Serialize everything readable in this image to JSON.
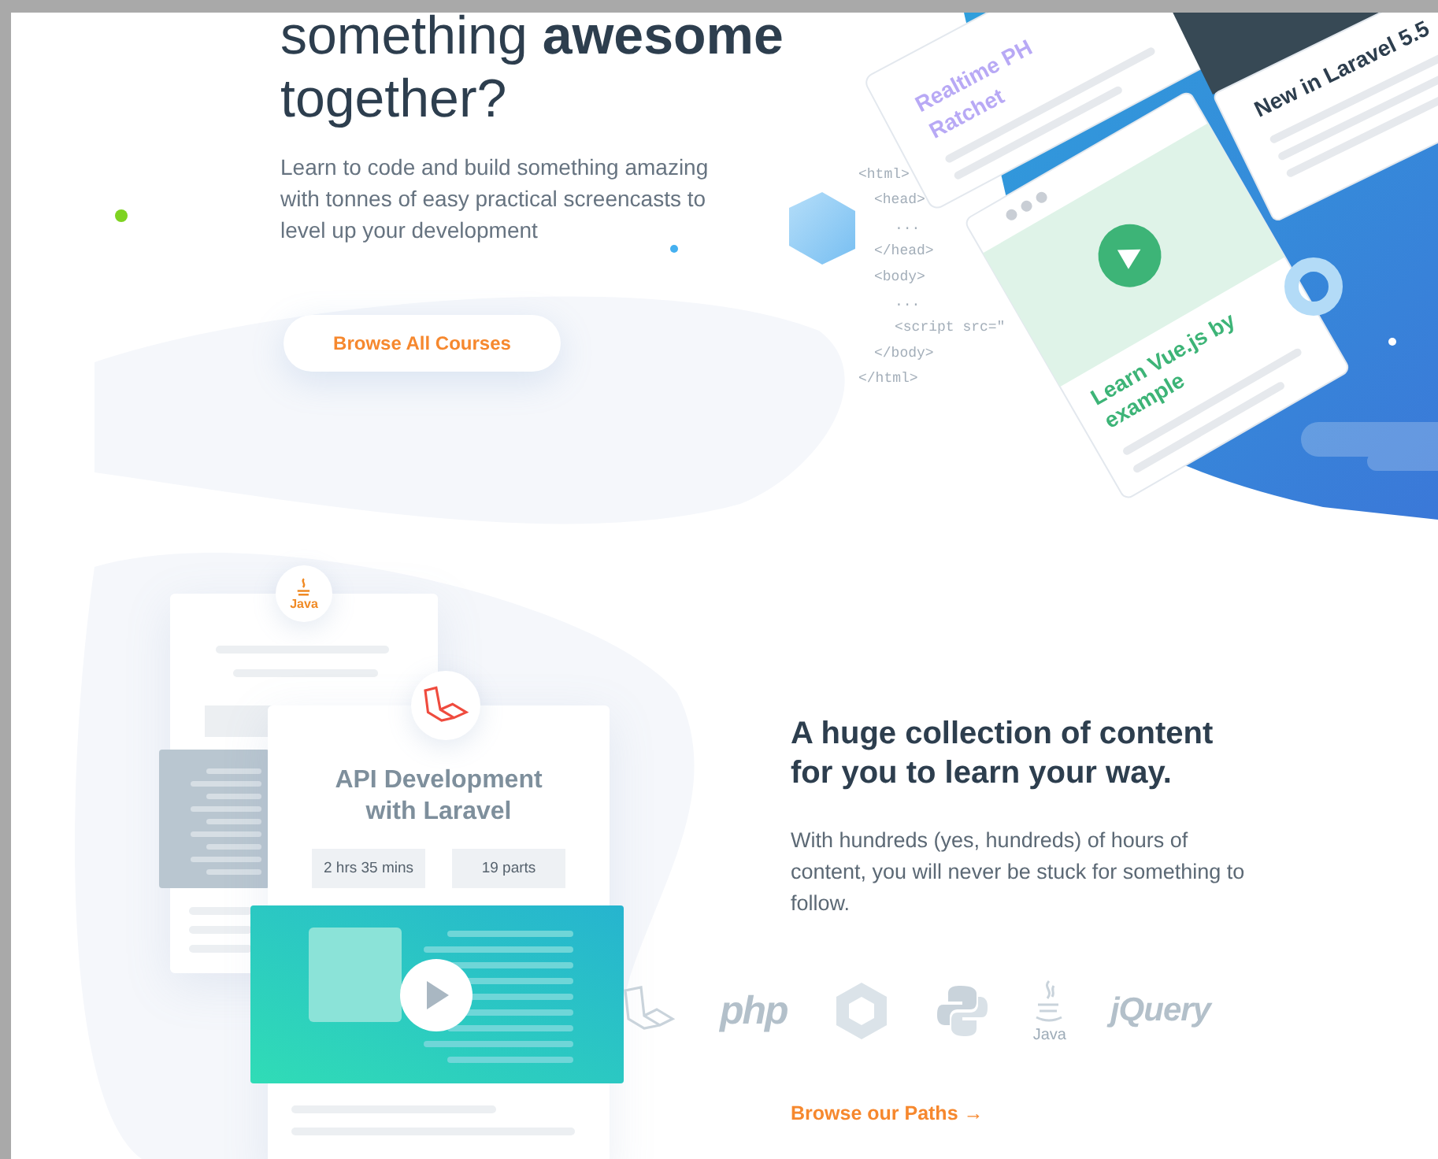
{
  "hero": {
    "title_lines": [
      "something **awesome**",
      "together?"
    ],
    "description": "Learn to code and build something amazing with tonnes of easy practical screencasts to level up your development",
    "button": "Browse All Courses"
  },
  "hero_illustration": {
    "cards": [
      {
        "kind": "course",
        "lines": [
          "Realtime PH",
          "Ratchet"
        ]
      },
      {
        "kind": "news",
        "lines": [
          "New in Laravel 5.5"
        ]
      },
      {
        "kind": "video",
        "lines": [
          "Learn Vue.js by",
          "example"
        ]
      }
    ],
    "code_lines": [
      "<html>",
      "<head>",
      "...",
      "</head>",
      "<body>",
      "...",
      "<script src=\"",
      "</body>",
      "</html>"
    ]
  },
  "course_card": {
    "badge_label": "Java",
    "title": "API Development with Laravel",
    "duration": "2 hrs 35 mins",
    "parts": "19 parts"
  },
  "section": {
    "heading": "A huge collection of content for you to learn your way.",
    "description": "With hundreds (yes, hundreds) of hours of content, you will never be stuck for something to follow.",
    "logos": [
      {
        "kind": "laravel"
      },
      {
        "kind": "php",
        "label": "php"
      },
      {
        "kind": "hexagon"
      },
      {
        "kind": "python"
      },
      {
        "kind": "java",
        "label": "Java"
      },
      {
        "kind": "jquery",
        "label": "jQuery"
      }
    ],
    "link": "Browse our Paths →"
  }
}
